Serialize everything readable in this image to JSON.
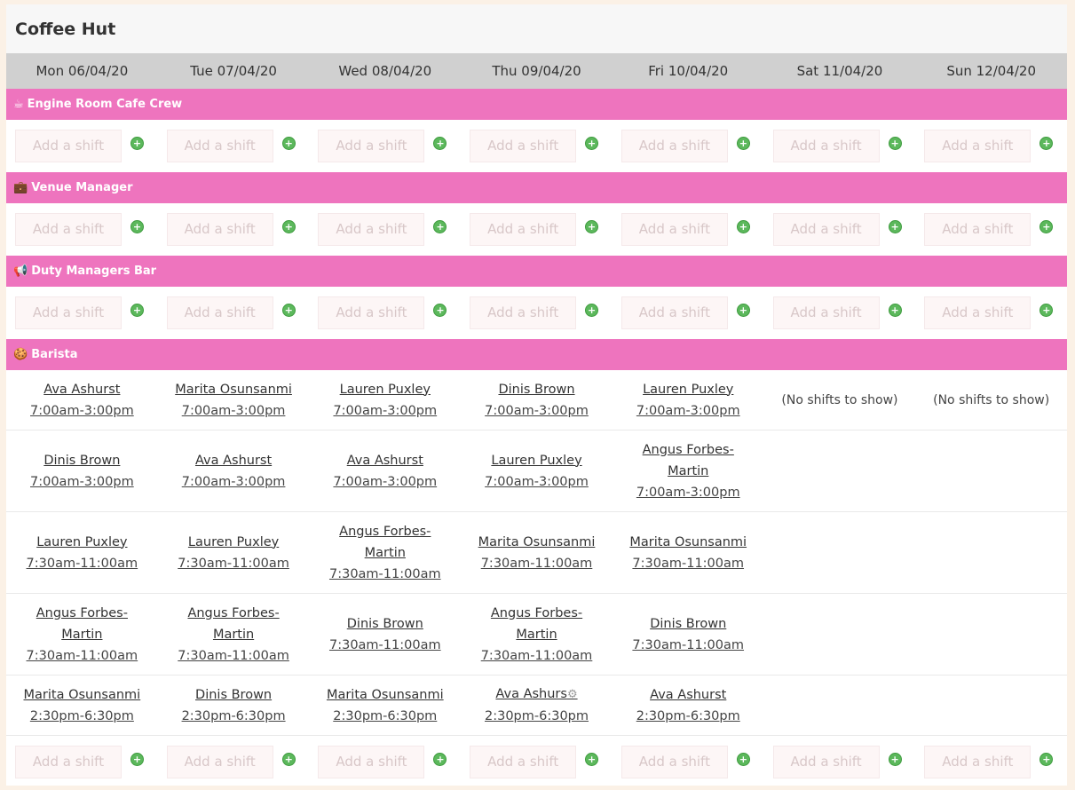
{
  "title": "Coffee Hut",
  "days": [
    "Mon 06/04/20",
    "Tue 07/04/20",
    "Wed 08/04/20",
    "Thu 09/04/20",
    "Fri 10/04/20",
    "Sat 11/04/20",
    "Sun 12/04/20"
  ],
  "add_placeholder": "Add a shift",
  "no_shifts": "(No shifts to show)",
  "sections": {
    "engine": {
      "icon": "☕",
      "label": "Engine Room Cafe Crew"
    },
    "venue": {
      "icon": "💼",
      "label": "Venue Manager"
    },
    "duty": {
      "icon": "📢",
      "label": "Duty Managers Bar"
    },
    "barista": {
      "icon": "🍪",
      "label": "Barista"
    }
  },
  "barista_rows": [
    [
      {
        "name": "Ava Ashurst",
        "time": "7:00am-3:00pm"
      },
      {
        "name": "Marita Osunsanmi",
        "time": "7:00am-3:00pm"
      },
      {
        "name": "Lauren Puxley",
        "time": "7:00am-3:00pm"
      },
      {
        "name": "Dinis Brown",
        "time": "7:00am-3:00pm"
      },
      {
        "name": "Lauren Puxley",
        "time": "7:00am-3:00pm"
      }
    ],
    [
      {
        "name": "Dinis Brown",
        "time": "7:00am-3:00pm"
      },
      {
        "name": "Ava Ashurst",
        "time": "7:00am-3:00pm"
      },
      {
        "name": "Ava Ashurst",
        "time": "7:00am-3:00pm"
      },
      {
        "name": "Lauren Puxley",
        "time": "7:00am-3:00pm"
      },
      {
        "name": "Angus Forbes-\nMartin",
        "time": "7:00am-3:00pm"
      }
    ],
    [
      {
        "name": "Lauren Puxley",
        "time": "7:30am-11:00am"
      },
      {
        "name": "Lauren Puxley",
        "time": "7:30am-11:00am"
      },
      {
        "name": "Angus Forbes-\nMartin",
        "time": "7:30am-11:00am"
      },
      {
        "name": "Marita Osunsanmi",
        "time": "7:30am-11:00am"
      },
      {
        "name": "Marita Osunsanmi",
        "time": "7:30am-11:00am"
      }
    ],
    [
      {
        "name": "Angus Forbes-\nMartin",
        "time": "7:30am-11:00am"
      },
      {
        "name": "Angus Forbes-\nMartin",
        "time": "7:30am-11:00am"
      },
      {
        "name": "Dinis Brown",
        "time": "7:30am-11:00am"
      },
      {
        "name": "Angus Forbes-\nMartin",
        "time": "7:30am-11:00am"
      },
      {
        "name": "Dinis Brown",
        "time": "7:30am-11:00am"
      }
    ],
    [
      {
        "name": "Marita Osunsanmi",
        "time": "2:30pm-6:30pm"
      },
      {
        "name": "Dinis Brown",
        "time": "2:30pm-6:30pm"
      },
      {
        "name": "Marita Osunsanmi",
        "time": "2:30pm-6:30pm"
      },
      {
        "name": "Ava Ashurs",
        "time": "2:30pm-6:30pm",
        "gear": "⚙"
      },
      {
        "name": "Ava Ashurst",
        "time": "2:30pm-6:30pm"
      }
    ]
  ],
  "colors": {
    "section": "#ee74be",
    "header": "#d0d0d0",
    "accent": "#5cb85c"
  }
}
